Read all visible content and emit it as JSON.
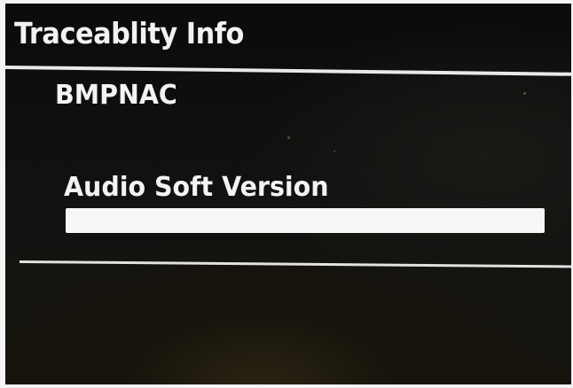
{
  "screen": {
    "title": "Traceablity Info",
    "items": [
      {
        "label": "BMPNAC"
      },
      {
        "label": "Audio Soft Version",
        "value": ""
      }
    ]
  }
}
